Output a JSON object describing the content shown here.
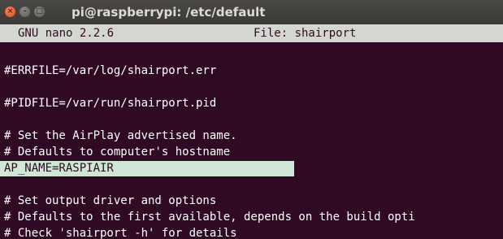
{
  "window": {
    "title": "pi@raspberrypi: /etc/default",
    "controls": {
      "close": "×",
      "minimize": "–",
      "maximize": "□"
    }
  },
  "nano": {
    "version": "GNU nano 2.2.6",
    "file": "File: shairport"
  },
  "lines": [
    "#ERRFILE=/var/log/shairport.err",
    "#PIDFILE=/var/run/shairport.pid",
    "# Set the AirPlay advertised name.",
    "# Defaults to computer's hostname",
    "AP_NAME=RASPIAIR",
    "# Set output driver and options",
    "# Defaults to the first available, depends on the build opti",
    "# Check 'shairport -h' for details"
  ],
  "colors": {
    "terminal_bg": "#300a24",
    "header_bg": "#d3d7cf",
    "highlight_bg": "#cfe8d5"
  }
}
